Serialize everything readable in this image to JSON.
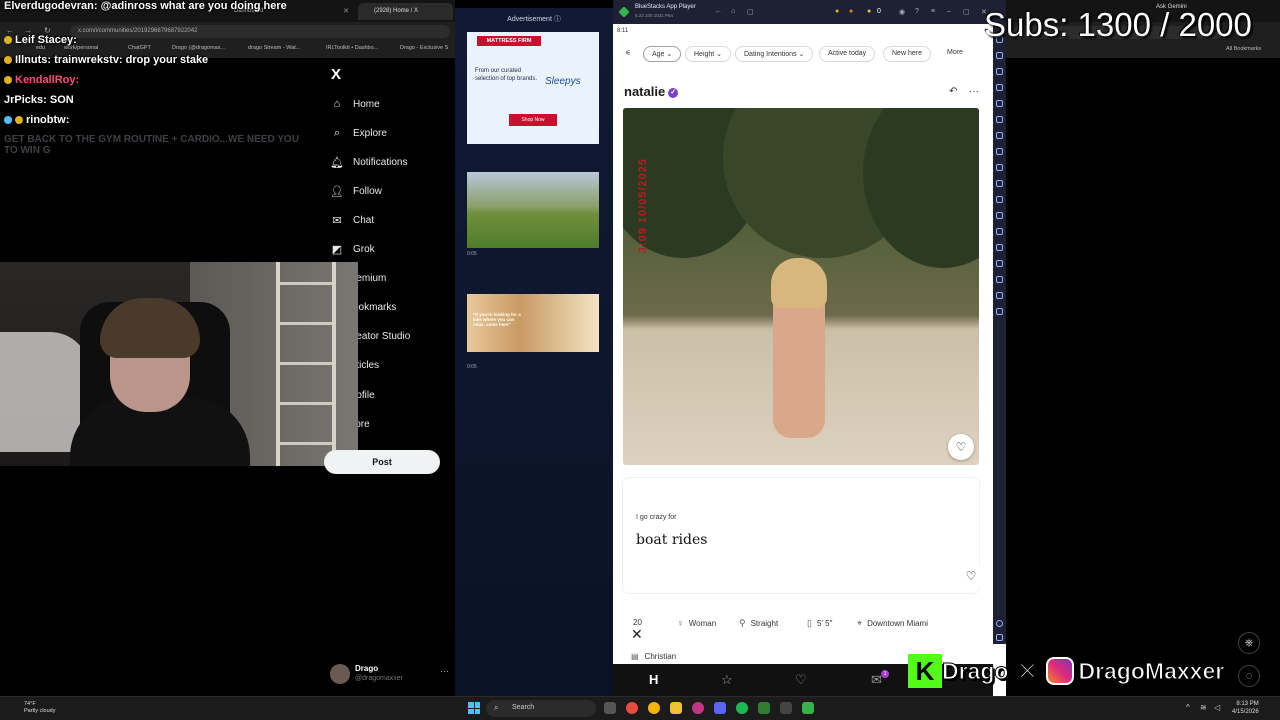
{
  "chat": {
    "lines": [
      {
        "user": "Elverdugodevran:",
        "msg": "@adinross what are you doing here"
      },
      {
        "user": "Leif Stacey:",
        "msg": ""
      },
      {
        "user": "Illnuts:",
        "msg": "trainwrekstv: drop your stake"
      },
      {
        "user": "KendallRoy:",
        "msg": ""
      },
      {
        "user": "JrPicks:",
        "msg": "SON"
      },
      {
        "user": "rinobtw:",
        "msg": ""
      }
    ],
    "faded": "GET BACK TO THE GYM ROUTINE + CARDIO...WE NEED YOU TO WIN G"
  },
  "browser_left": {
    "tabs": [
      "Dashboard",
      "(2928) Home / X"
    ],
    "url": "x.com/i/communities/2019296879687922042",
    "bookmarks": [
      "edu",
      "work/personal",
      "ChatGPT",
      "Drago (@dragomax...",
      "drago Stream - Wat...",
      "IRLToolkit • Dashbo...",
      "Drago - Exclusive S"
    ]
  },
  "x_sidebar": {
    "logo": "X",
    "items": [
      {
        "label": "Home",
        "icon": "home-icon"
      },
      {
        "label": "Explore",
        "icon": "search-icon"
      },
      {
        "label": "Notifications",
        "icon": "bell-icon"
      },
      {
        "label": "Follow",
        "icon": "follow-icon"
      },
      {
        "label": "Chat",
        "icon": "chat-icon"
      },
      {
        "label": "Grok",
        "icon": "grok-icon"
      },
      {
        "label": "remium",
        "icon": "premium-icon"
      },
      {
        "label": "ookmarks",
        "icon": "bookmark-icon"
      },
      {
        "label": "reator Studio",
        "icon": "studio-icon"
      },
      {
        "label": "rticles",
        "icon": "article-icon"
      },
      {
        "label": "rofile",
        "icon": "profile-icon"
      },
      {
        "label": "lore",
        "icon": "more-icon"
      }
    ],
    "post_label": "Post",
    "profile": {
      "name": "Drago",
      "handle": "@dragomaxxer"
    }
  },
  "ad_column": {
    "label": "Advertisement ⓘ",
    "ad": {
      "brand": "MATTRESS FIRM",
      "text": "From our curated selection of top brands.",
      "logo": "Sleepys",
      "cta": "Shop Now"
    },
    "videos": [
      {
        "duration": "0:05",
        "caption": ""
      },
      {
        "duration": "0:05",
        "caption": "\"If you're looking for a lake where you can relax, come here\""
      }
    ]
  },
  "bluestacks": {
    "title": "BlueStacks App Player",
    "version": "5.22.100.1031 P64",
    "status_time": "8:11",
    "filters": [
      "Age",
      "Height",
      "Dating Intentions",
      "Active today",
      "New here",
      "More"
    ],
    "profile_name": "natalie",
    "photo_watermark": "3:09 10/05/2025",
    "prompt": {
      "question": "I go crazy for",
      "answer": "boat rides"
    },
    "vitals": [
      {
        "icon": "cake-icon",
        "label": "20"
      },
      {
        "icon": "gender-icon",
        "label": "Woman"
      },
      {
        "icon": "orientation-icon",
        "label": "Straight"
      },
      {
        "icon": "height-icon",
        "label": "5' 5\""
      },
      {
        "icon": "location-icon",
        "label": "Downtown Miami"
      }
    ],
    "religion": "Christian",
    "bottom_nav": [
      "H",
      "☆",
      "♡",
      "✉"
    ],
    "badge": "1"
  },
  "overlay": {
    "subs": "Subs: 1300 / 2000",
    "social_kick": "Drago",
    "social_insta": "DragoMaxxer",
    "ask_gemini": "Ask Gemini",
    "all_bookmarks": "All Bookmarks"
  },
  "taskbar": {
    "weather_temp": "74°F",
    "weather_desc": "Partly cloudy",
    "search": "Search",
    "time": "8:13 PM",
    "date": "4/15/2026"
  },
  "colors": {
    "kick_green": "#53fc18",
    "hinge_purple": "#7a42c8",
    "x_bg": "#000000",
    "bluestacks_dark": "#1d2133"
  }
}
